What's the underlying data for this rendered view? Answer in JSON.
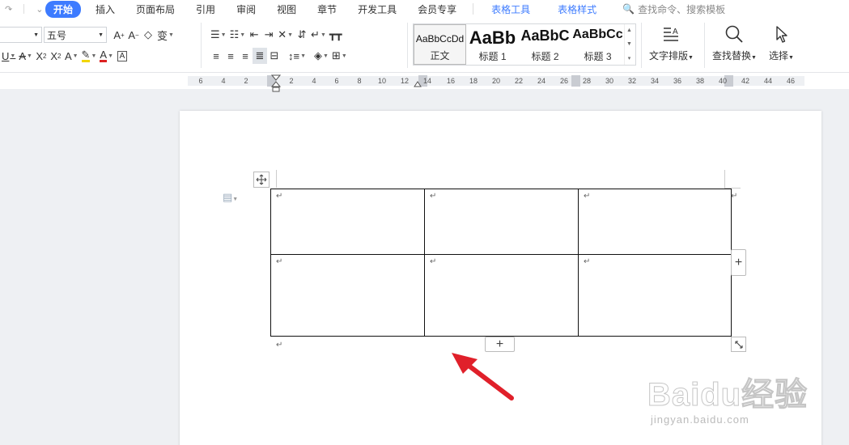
{
  "menu": {
    "tabs": [
      "开始",
      "插入",
      "页面布局",
      "引用",
      "审阅",
      "视图",
      "章节",
      "开发工具",
      "会员专享"
    ],
    "context_tabs": [
      "表格工具",
      "表格样式"
    ],
    "search_label": "查找命令、搜索模板"
  },
  "ribbon": {
    "font_size": "五号",
    "styles": [
      {
        "sample": "AaBbCcDd",
        "name": "正文"
      },
      {
        "sample": "AaBb",
        "name": "标题 1"
      },
      {
        "sample": "AaBbC",
        "name": "标题 2"
      },
      {
        "sample": "AaBbCc",
        "name": "标题 3"
      }
    ],
    "text_layout": "文字排版",
    "find_replace": "查找替换",
    "select": "选择"
  },
  "ruler": {
    "numbers": [
      "6",
      "4",
      "2",
      "2",
      "4",
      "6",
      "8",
      "10",
      "12",
      "14",
      "16",
      "18",
      "20",
      "22",
      "24",
      "26",
      "28",
      "30",
      "32",
      "34",
      "36",
      "38",
      "40",
      "42",
      "44",
      "46"
    ]
  },
  "table": {
    "rows": 2,
    "cols": 3,
    "paragraph_mark": "↵"
  },
  "controls": {
    "add_column": "+",
    "add_row": "+"
  },
  "watermark": {
    "main": "Baidu经验",
    "sub": "jingyan.baidu.com"
  },
  "colors": {
    "accent": "#3d7bff",
    "arrow": "#e0202a"
  }
}
